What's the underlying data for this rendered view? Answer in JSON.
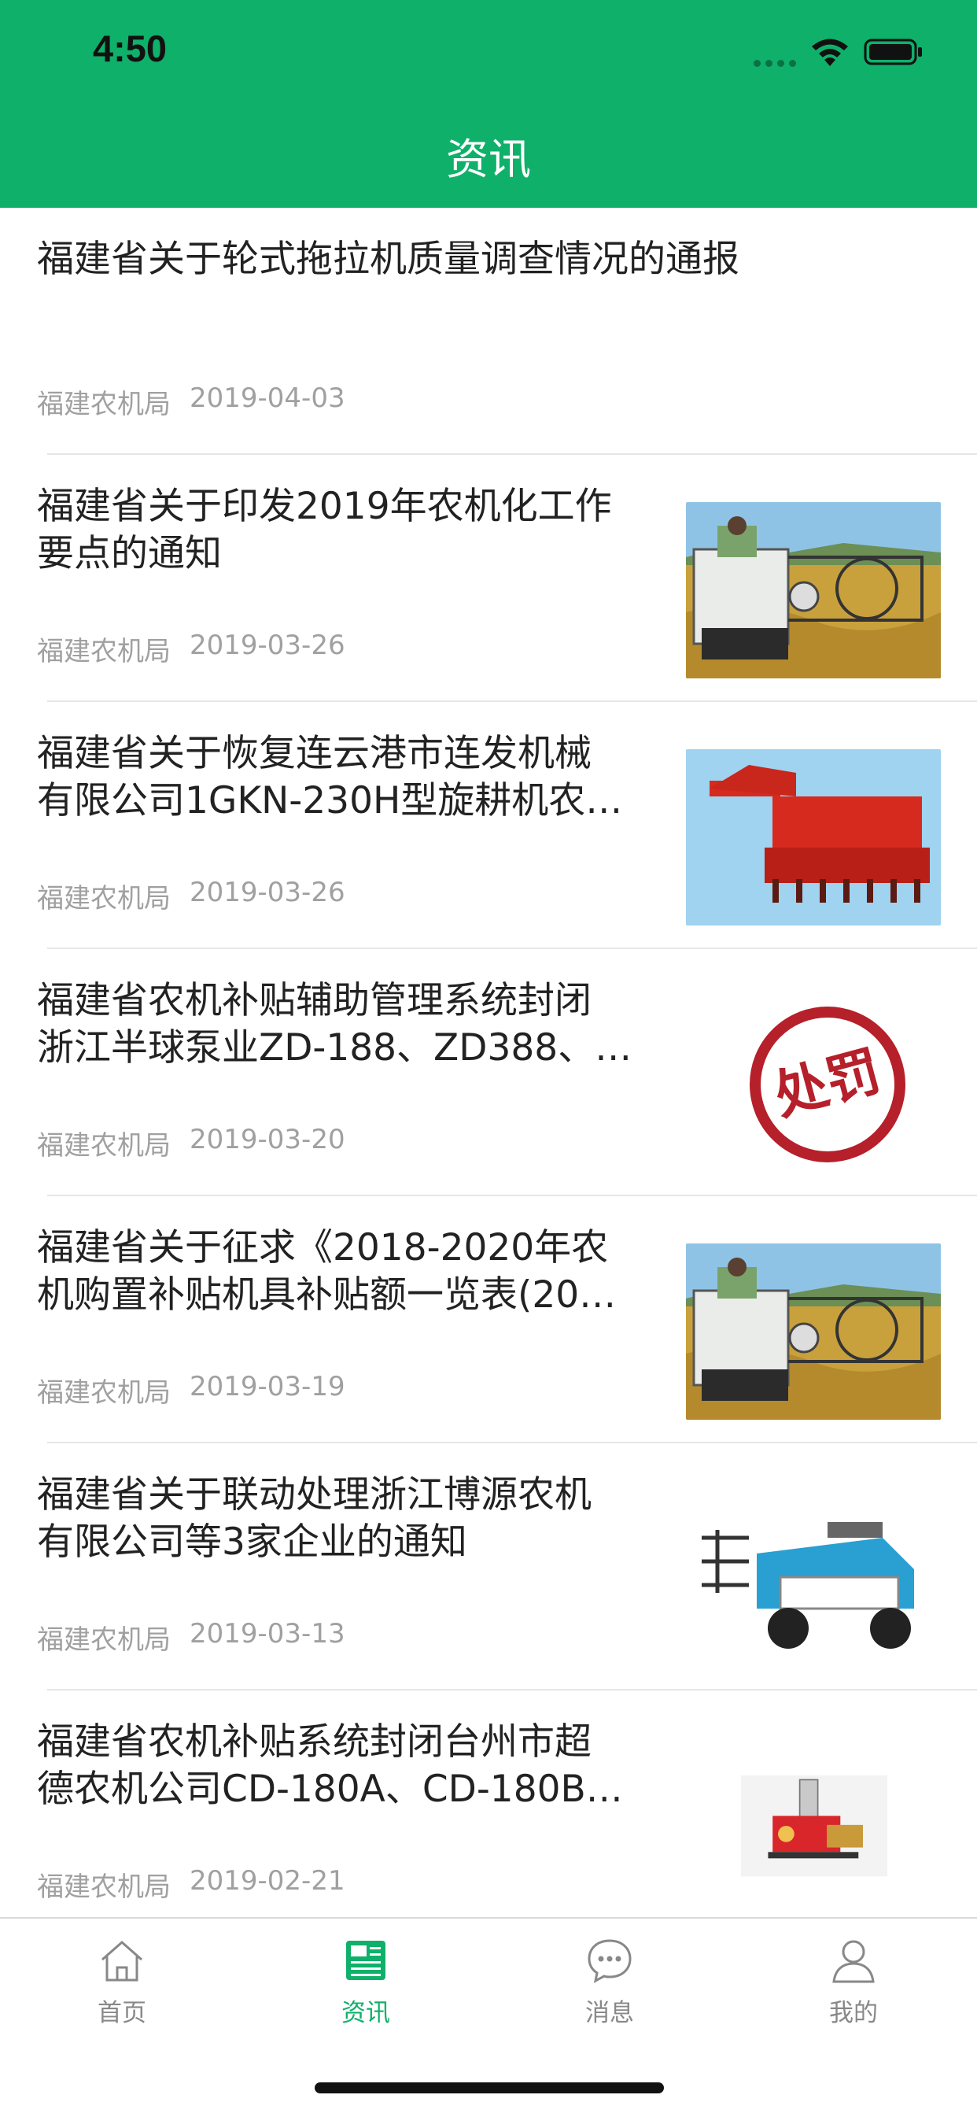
{
  "status_bar": {
    "time": "4:50"
  },
  "header": {
    "title": "资讯"
  },
  "news": [
    {
      "title_lines": [
        "福建省关于轮式拖拉机质量调查情况的通报"
      ],
      "source": "福建农机局",
      "date": "2019-04-03",
      "thumbnail": "none"
    },
    {
      "title_lines": [
        "福建省关于印发2019年农机化工作",
        "要点的通知"
      ],
      "source": "福建农机局",
      "date": "2019-03-26",
      "thumbnail": "harvester"
    },
    {
      "title_lines": [
        "福建省关于恢复连云港市连发机械",
        "有限公司1GKN-230H型旋耕机农…"
      ],
      "source": "福建农机局",
      "date": "2019-03-26",
      "thumbnail": "rotary-tiller"
    },
    {
      "title_lines": [
        "福建省农机补贴辅助管理系统封闭",
        "浙江半球泵业ZD-188、ZD388、…"
      ],
      "source": "福建农机局",
      "date": "2019-03-20",
      "thumbnail": "penalty-stamp",
      "stamp_text": "处罚"
    },
    {
      "title_lines": [
        "福建省关于征求《2018-2020年农",
        "机购置补贴机具补贴额一览表(20…"
      ],
      "source": "福建农机局",
      "date": "2019-03-19",
      "thumbnail": "harvester"
    },
    {
      "title_lines": [
        "福建省关于联动处理浙江博源农机",
        "有限公司等3家企业的通知"
      ],
      "source": "福建农机局",
      "date": "2019-03-13",
      "thumbnail": "rice-transplanter"
    },
    {
      "title_lines": [
        "福建省农机补贴系统封闭台州市超",
        "德农机公司CD-180A、CD-180B…"
      ],
      "source": "福建农机局",
      "date": "2019-02-21",
      "thumbnail": "sprayer-pump"
    }
  ],
  "tabbar": {
    "tabs": [
      {
        "label": "首页",
        "icon": "home-icon",
        "active": false
      },
      {
        "label": "资讯",
        "icon": "news-icon",
        "active": true
      },
      {
        "label": "消息",
        "icon": "message-icon",
        "active": false
      },
      {
        "label": "我的",
        "icon": "profile-icon",
        "active": false
      }
    ]
  },
  "colors": {
    "brand": "#0fb06a",
    "meta_text": "#a0a0a0",
    "tab_inactive": "#888888"
  }
}
